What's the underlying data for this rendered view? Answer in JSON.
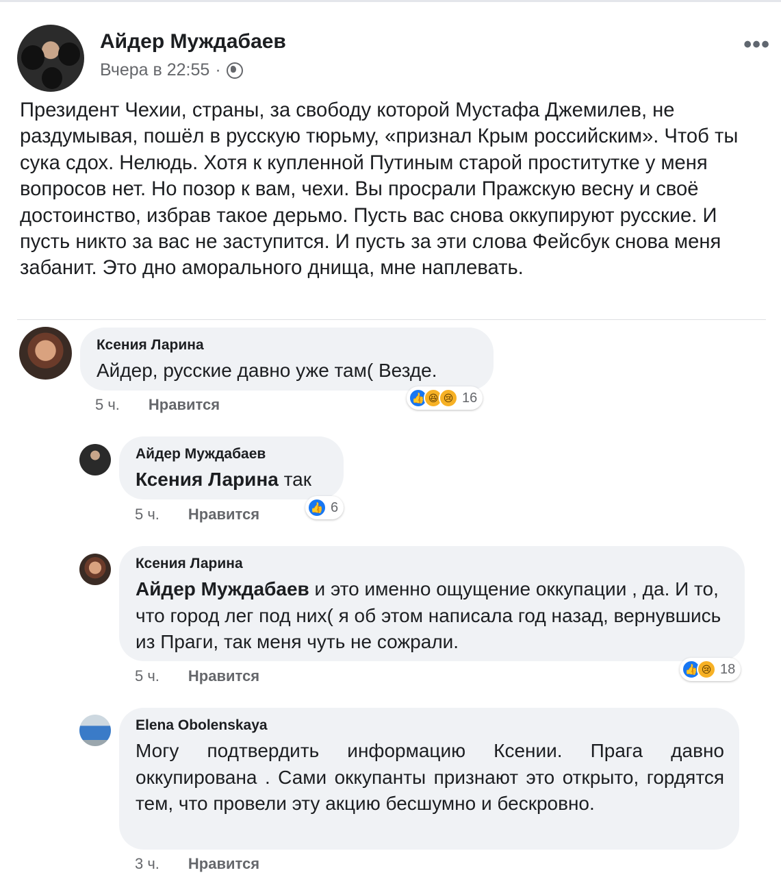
{
  "post": {
    "author": "Айдер Муждабаев",
    "time": "Вчера в 22:55",
    "separator": "·",
    "more_icon": "more-horizontal-icon",
    "privacy_icon": "globe-icon",
    "text": "Президент Чехии, страны, за свободу которой Мустафа Джемилев, не раздумывая, пошёл в русскую тюрьму, «признал Крым российским». Чтоб ты сука сдох. Нелюдь. Хотя к купленной Путиным старой проститутке у меня вопросов нет. Но позор к вам, чехи. Вы просрали Пражскую весну и своё достоинство, избрав такое дерьмо. Пусть вас снова оккупируют русские. И пусть никто за вас не заступится. И пусть за эти слова Фейсбук снова меня забанит. Это дно аморального днища, мне наплевать."
  },
  "comments": [
    {
      "author": "Ксения Ларина",
      "text": "Айдер, русские давно уже там( Везде.",
      "time": "5 ч.",
      "like": "Нравится",
      "reactions": [
        "like",
        "haha",
        "sad"
      ],
      "reaction_count": "16"
    },
    {
      "author": "Айдер Муждабаев",
      "mention": "Ксения Ларина",
      "text": " так",
      "time": "5 ч.",
      "like": "Нравится",
      "reactions": [
        "like"
      ],
      "reaction_count": "6"
    },
    {
      "author": "Ксения Ларина",
      "mention": "Айдер Муждабаев",
      "text": " и это именно ощущение оккупации , да. И то, что город лег под них( я об этом написала год назад, вернувшись из Праги, так меня чуть не сожрали.",
      "time": "5 ч.",
      "like": "Нравится",
      "reactions": [
        "like",
        "sad"
      ],
      "reaction_count": "18"
    },
    {
      "author": "Elena Obolenskaya",
      "text": "Могу подтвердить информацию Ксении. Прага давно оккупирована . Сами оккупанты  признают это открыто, гордятся тем, что  провели эту акцию бесшумно и бескровно.",
      "time": "3 ч.",
      "like": "Нравится"
    }
  ],
  "colors": {
    "like_blue": "#1877f2",
    "emoji_yellow": "#f7b125",
    "bubble": "#f0f2f5",
    "meta_gray": "#65676b"
  }
}
